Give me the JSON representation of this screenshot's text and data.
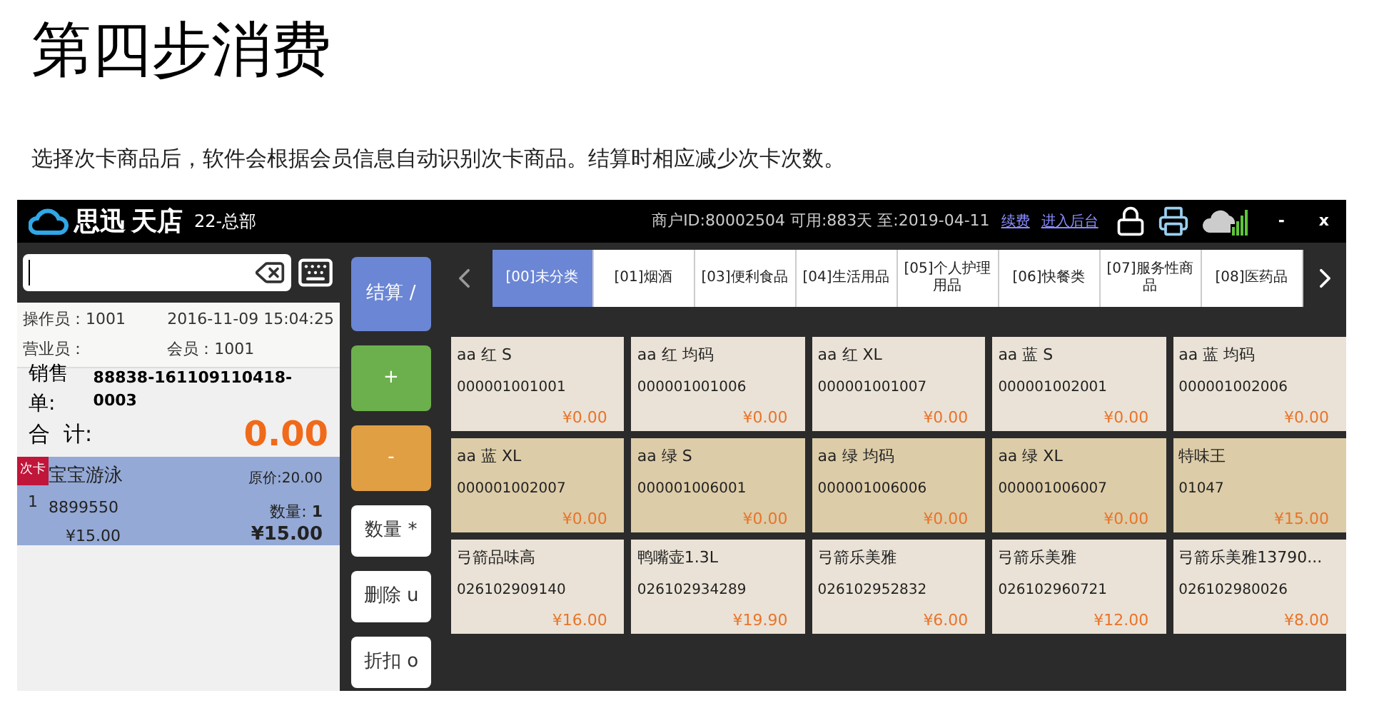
{
  "heading": "第四步消费",
  "intro": "选择次卡商品后，软件会根据会员信息自动识别次卡商品。结算时相应减少次卡次数。",
  "app": {
    "logo_text": "思迅",
    "logo_text_2": "天店",
    "branch": "22-总部",
    "account_info": "商户ID:80002504 可用:883天 至:2019-04-11",
    "links": [
      "续费",
      "进入后台"
    ],
    "window_buttons": [
      "-",
      "x"
    ]
  },
  "order": {
    "operator_label": "操作员：",
    "operator": "1001",
    "datetime": "2016-11-09 15:04:25",
    "clerk_label": "营业员：",
    "member_label": "会员：",
    "member": "1001",
    "sale_no_label": "销售单:",
    "sale_no": "88838-161109110418-0003",
    "total_label": "合  计:",
    "total": "0.00",
    "items": [
      {
        "badge": "次卡",
        "index": "1",
        "name": "宝宝游泳",
        "code": "8899550",
        "price": "¥15.00",
        "original_price": "原价:20.00",
        "qty_label": "数量:",
        "qty": "1",
        "amount": "¥15.00",
        "selected": true
      }
    ]
  },
  "actions": [
    {
      "label": "结算 /",
      "kind": "checkout"
    },
    {
      "label": "+",
      "kind": "plus"
    },
    {
      "label": "-",
      "kind": "minus"
    },
    {
      "label": "数量 *",
      "kind": "plain"
    },
    {
      "label": "删除 u",
      "kind": "plain"
    },
    {
      "label": "折扣 o",
      "kind": "plain"
    }
  ],
  "categories": [
    {
      "label": "[00]未分类",
      "selected": true
    },
    {
      "label": "[01]烟酒",
      "selected": false
    },
    {
      "label": "[03]便利食品",
      "selected": false
    },
    {
      "label": "[04]生活用品",
      "selected": false
    },
    {
      "label": "[05]个人护理用品",
      "selected": false
    },
    {
      "label": "[06]快餐类",
      "selected": false
    },
    {
      "label": "[07]服务性商品",
      "selected": false
    },
    {
      "label": "[08]医药品",
      "selected": false
    }
  ],
  "products": [
    {
      "name": "aa 红 S",
      "code": "000001001001",
      "price": "¥0.00"
    },
    {
      "name": "aa 红 均码",
      "code": "000001001006",
      "price": "¥0.00"
    },
    {
      "name": "aa 红 XL",
      "code": "000001001007",
      "price": "¥0.00"
    },
    {
      "name": "aa 蓝 S",
      "code": "000001002001",
      "price": "¥0.00"
    },
    {
      "name": "aa 蓝 均码",
      "code": "000001002006",
      "price": "¥0.00"
    },
    {
      "name": "aa 蓝 XL",
      "code": "000001002007",
      "price": "¥0.00"
    },
    {
      "name": "aa 绿 S",
      "code": "000001006001",
      "price": "¥0.00"
    },
    {
      "name": "aa 绿 均码",
      "code": "000001006006",
      "price": "¥0.00"
    },
    {
      "name": "aa 绿 XL",
      "code": "000001006007",
      "price": "¥0.00"
    },
    {
      "name": "特味王",
      "code": "01047",
      "price": "¥15.00"
    },
    {
      "name": "弓箭品味高",
      "code": "026102909140",
      "price": "¥16.00"
    },
    {
      "name": "鸭嘴壶1.3L",
      "code": "026102934289",
      "price": "¥19.90"
    },
    {
      "name": "弓箭乐美雅",
      "code": "026102952832",
      "price": "¥6.00"
    },
    {
      "name": "弓箭乐美雅",
      "code": "026102960721",
      "price": "¥12.00"
    },
    {
      "name": "弓箭乐美雅13790...",
      "code": "026102980026",
      "price": "¥8.00"
    }
  ]
}
